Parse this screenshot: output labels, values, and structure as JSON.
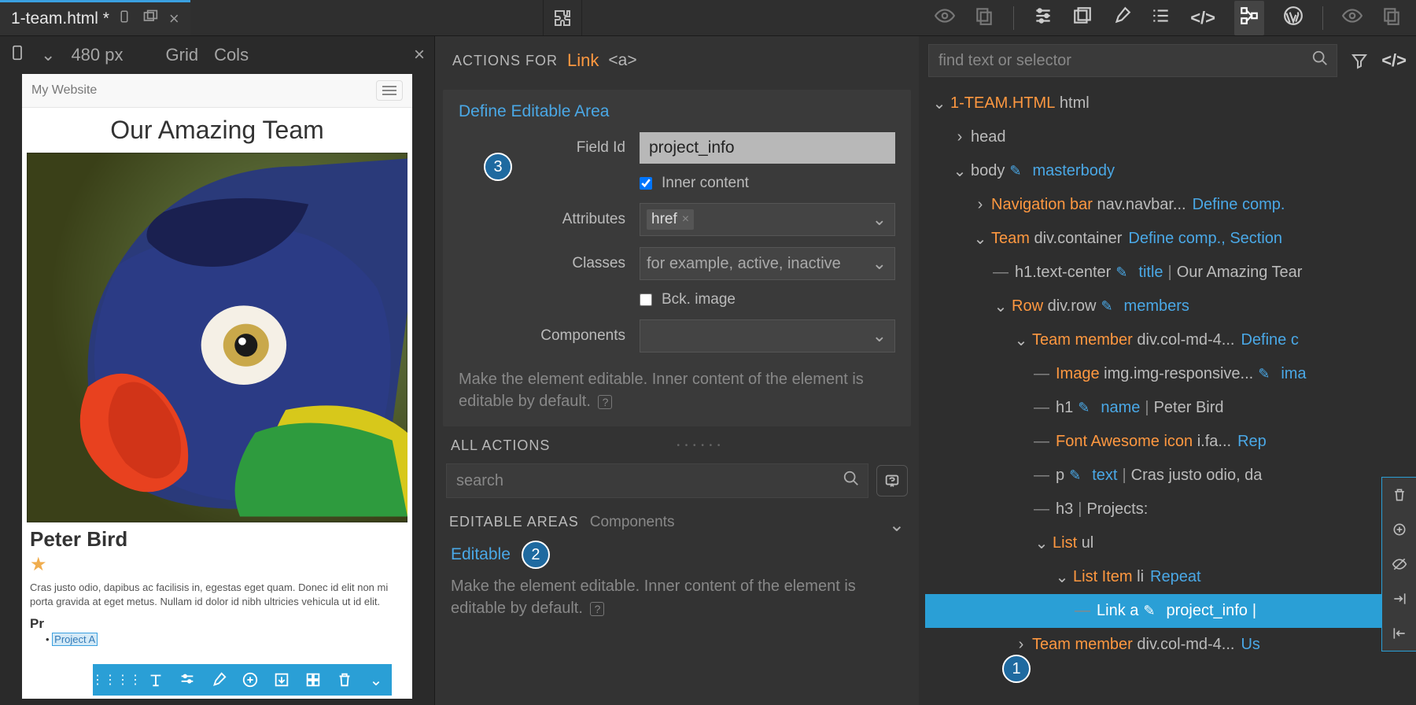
{
  "tab": {
    "filename": "1-team.html *"
  },
  "left_toolbar": {
    "width_label": "480 px",
    "grid": "Grid",
    "cols": "Cols"
  },
  "preview": {
    "site_title": "My Website",
    "heading": "Our Amazing Team",
    "member_name": "Peter Bird",
    "member_desc": "Cras justo odio, dapibus ac facilisis in, egestas eget quam. Donec id elit non mi porta gravida at eget metus. Nullam id dolor id nibh ultricies vehicula ut id elit.",
    "projects_label": "Pr",
    "project_link": "Project A"
  },
  "actions": {
    "actions_for": "ACTIONS FOR",
    "selected_label": "Link",
    "selected_tag": "<a>",
    "define_editable_title": "Define Editable Area",
    "field_id_label": "Field Id",
    "field_id_value": "project_info",
    "inner_content_label": "Inner content",
    "attributes_label": "Attributes",
    "attribute_chip": "href",
    "classes_label": "Classes",
    "classes_placeholder": "for example, active, inactive",
    "bck_image_label": "Bck. image",
    "components_label": "Components",
    "hint1": "Make the element editable. Inner content of the element is editable by default.",
    "all_actions": "ALL ACTIONS",
    "search_placeholder": "search",
    "editable_areas": "EDITABLE AREAS",
    "editable_areas_sub": "Components",
    "editable_label": "Editable",
    "hint2": "Make the element editable. Inner content of the element is editable by default."
  },
  "tree": {
    "find_placeholder": "find text or selector",
    "root_file": "1-TEAM.HTML",
    "root_tag": "html",
    "nodes": {
      "head": "head",
      "body": "body",
      "body_meta": "masterbody",
      "nav_label": "Navigation bar",
      "nav_tag": "nav.navbar...",
      "nav_meta": "Define comp.",
      "team_label": "Team",
      "team_tag": "div.container",
      "team_meta": "Define comp., Section",
      "h1_tag": "h1.text-center",
      "h1_meta": "title",
      "h1_after": "Our Amazing Tear",
      "row_label": "Row",
      "row_tag": "div.row",
      "row_meta": "members",
      "tm_label": "Team member",
      "tm_tag": "div.col-md-4...",
      "tm_meta": "Define c",
      "img_label": "Image",
      "img_tag": "img.img-responsive...",
      "img_meta": "ima",
      "h1b_tag": "h1",
      "h1b_meta": "name",
      "h1b_after": "Peter Bird",
      "fa_label": "Font Awesome icon",
      "fa_tag": "i.fa...",
      "fa_meta": "Rep",
      "p_tag": "p",
      "p_meta": "text",
      "p_after": "Cras justo odio, da",
      "h3_tag": "h3",
      "h3_after": "Projects:",
      "list_label": "List",
      "list_tag": "ul",
      "li_label": "List Item",
      "li_tag": "li",
      "li_meta": "Repeat",
      "link_label": "Link",
      "link_tag": "a",
      "link_meta": "project_info",
      "tm2_label": "Team member",
      "tm2_tag": "div.col-md-4...",
      "tm2_meta": "Us"
    }
  },
  "badges": {
    "b1": "1",
    "b2": "2",
    "b3": "3"
  }
}
